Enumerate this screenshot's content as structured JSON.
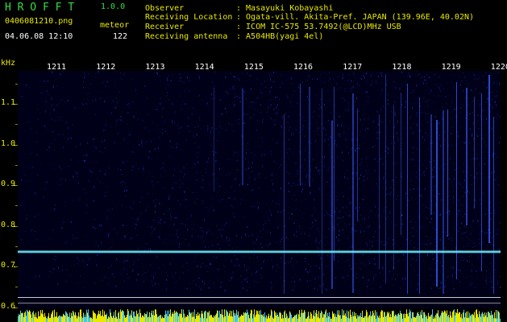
{
  "app": {
    "name": "H R O F F T",
    "version": "1.0.0"
  },
  "file": {
    "name": "0406081210.png",
    "datetime": "04.06.08 12:10"
  },
  "counter": {
    "label": "meteor",
    "value": "122"
  },
  "station": {
    "observer_label": "Observer",
    "observer_value": ": Masayuki Kobayashi",
    "location_label": "Receiving Location",
    "location_value": ": Ogata-vill. Akita-Pref. JAPAN (139.96E, 40.02N)",
    "receiver_label": "Receiver",
    "receiver_value": ": ICOM IC-575 53.7492(@LCD)MHz USB",
    "antenna_label": "Receiving antenna",
    "antenna_value": ": A504HB(yagi 4el)"
  },
  "axis": {
    "unit": "kHz",
    "time_ticks": [
      "1211",
      "1212",
      "1213",
      "1214",
      "1215",
      "1216",
      "1217",
      "1218",
      "1219",
      "1220"
    ],
    "freq_ticks": [
      {
        "label": "1.1",
        "value": 1.1
      },
      {
        "label": "1.0",
        "value": 1.0
      },
      {
        "label": "0.9",
        "value": 0.9
      },
      {
        "label": "0.8",
        "value": 0.8
      },
      {
        "label": "0.7",
        "value": 0.7
      },
      {
        "label": "0.6",
        "value": 0.6
      }
    ]
  },
  "colors": {
    "title": "#33dd44",
    "tick": "#e8e800",
    "signal": "#3a5cff",
    "carrier": "#4fd6ff"
  }
}
